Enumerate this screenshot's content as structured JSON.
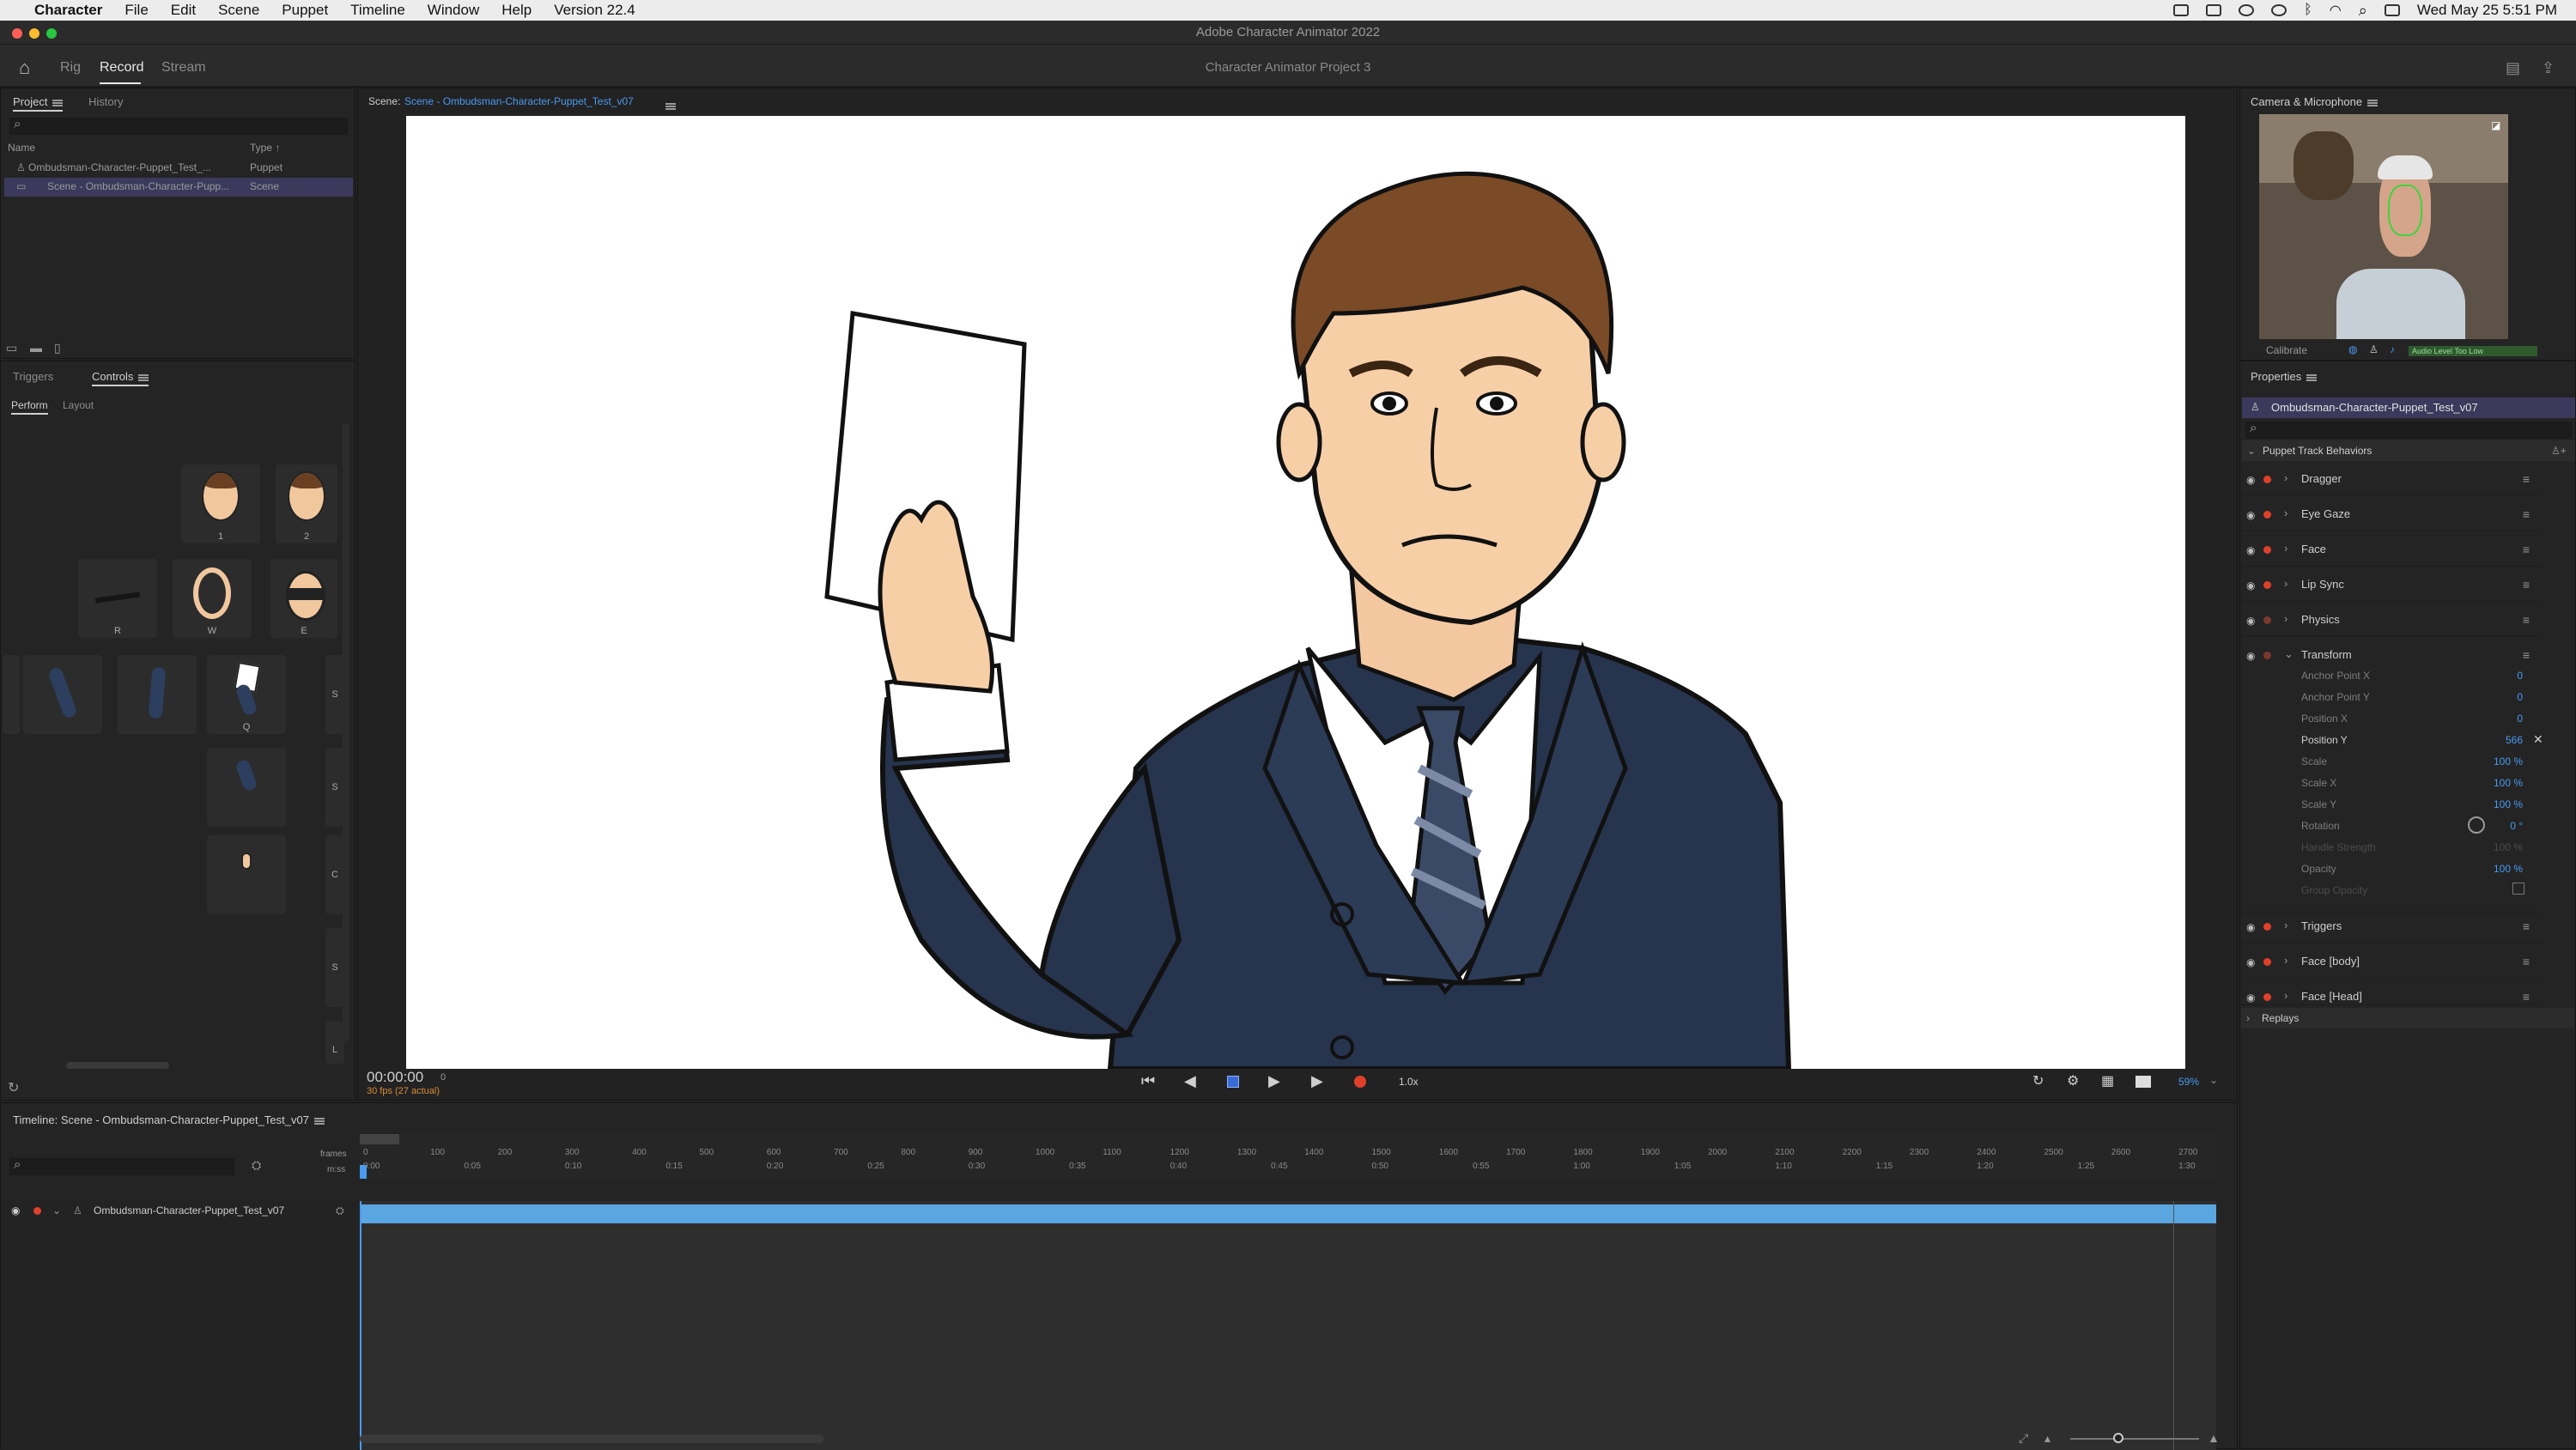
{
  "menubar": {
    "app_name": "Character",
    "items": [
      "File",
      "Edit",
      "Scene",
      "Puppet",
      "Timeline",
      "Window",
      "Help",
      "Version 22.4"
    ],
    "clock": "Wed May 25  5:51 PM"
  },
  "window": {
    "title": "Adobe Character Animator 2022",
    "project_title": "Character Animator Project 3"
  },
  "modes": {
    "rig": "Rig",
    "record": "Record",
    "stream": "Stream",
    "active": "Record"
  },
  "project_panel": {
    "tabs": [
      "Project",
      "History"
    ],
    "columns": {
      "name": "Name",
      "type": "Type"
    },
    "rows": [
      {
        "name": "Ombudsman-Character-Puppet_Test_...",
        "type": "Puppet"
      },
      {
        "name": "Scene - Ombudsman-Character-Pupp...",
        "type": "Scene"
      }
    ]
  },
  "controls_panel": {
    "tabs": [
      "Triggers",
      "Controls"
    ],
    "subtabs": [
      "Perform",
      "Layout"
    ],
    "tiles": [
      {
        "label": "1"
      },
      {
        "label": "2"
      },
      {
        "label": "R"
      },
      {
        "label": "W"
      },
      {
        "label": "E"
      },
      {
        "label": "Q"
      }
    ],
    "edge_letters": [
      "S",
      "S",
      "C",
      "S",
      "L"
    ]
  },
  "scene_panel": {
    "label": "Scene:",
    "name": "Scene - Ombudsman-Character-Puppet_Test_v07",
    "timecode": "00:00:00",
    "frame": "0",
    "fps": "30 fps (27 actual)",
    "speed": "1.0x",
    "zoom": "59%"
  },
  "camera_panel": {
    "title": "Camera & Microphone",
    "calibrate": "Calibrate",
    "audio_status": "Audio Level Too Low"
  },
  "properties_panel": {
    "title": "Properties",
    "puppet_name": "Ombudsman-Character-Puppet_Test_v07",
    "section": "Puppet Track Behaviors",
    "behaviors": [
      "Dragger",
      "Eye Gaze",
      "Face",
      "Lip Sync",
      "Physics",
      "Transform",
      "Triggers",
      "Face [body]",
      "Face [Head]"
    ],
    "transform_params": [
      {
        "name": "Anchor Point X",
        "value": "0"
      },
      {
        "name": "Anchor Point Y",
        "value": "0"
      },
      {
        "name": "Position X",
        "value": "0"
      },
      {
        "name": "Position Y",
        "value": "566"
      },
      {
        "name": "Scale",
        "value": "100 %"
      },
      {
        "name": "Scale X",
        "value": "100 %"
      },
      {
        "name": "Scale Y",
        "value": "100 %"
      },
      {
        "name": "Rotation",
        "value": "0 °"
      },
      {
        "name": "Handle Strength",
        "value": "100 %"
      },
      {
        "name": "Opacity",
        "value": "100 %"
      },
      {
        "name": "Group Opacity",
        "value": ""
      }
    ],
    "replays": "Replays"
  },
  "timeline": {
    "title": "Timeline: Scene - Ombudsman-Character-Puppet_Test_v07",
    "frames_label": "frames",
    "mss_label": "m:ss",
    "frame_ticks": [
      "0",
      "100",
      "200",
      "300",
      "400",
      "500",
      "600",
      "700",
      "800",
      "900",
      "1000",
      "1100",
      "1200",
      "1300",
      "1400",
      "1500",
      "1600",
      "1700",
      "1800",
      "1900",
      "2000",
      "2100",
      "2200",
      "2300",
      "2400",
      "2500",
      "2600",
      "2700"
    ],
    "time_ticks": [
      "0:00",
      "0:05",
      "0:10",
      "0:15",
      "0:20",
      "0:25",
      "0:30",
      "0:35",
      "0:40",
      "0:45",
      "0:50",
      "0:55",
      "1:00",
      "1:05",
      "1:10",
      "1:15",
      "1:20",
      "1:25",
      "1:30"
    ],
    "track_name": "Ombudsman-Character-Puppet_Test_v07"
  },
  "colors": {
    "accent_blue": "#4a9af0",
    "track_blue": "#5aa6e0",
    "record_red": "#e0402a",
    "selected_row": "#3b3a5c"
  }
}
